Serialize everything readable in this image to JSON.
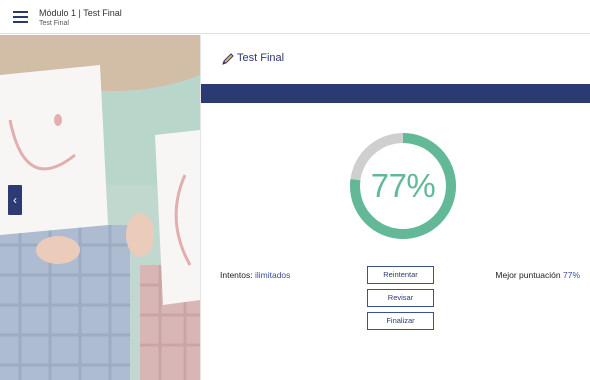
{
  "header": {
    "course_title": "Módulo 1 | Test Final",
    "course_subtitle": "Test Final",
    "menu_icon": "hamburger-menu-icon"
  },
  "sidebar": {
    "back_icon": "chevron-left-icon",
    "back_glyph": "‹"
  },
  "panel": {
    "title": "Test Final",
    "title_icon": "pencil-icon",
    "score_label": "77%",
    "score_value": 0.77,
    "attempts_label": "Intentos:",
    "attempts_value": "ilimitados",
    "best_label": "Mejor puntuación",
    "best_value": "77%",
    "buttons": {
      "retry": "Reintentar",
      "review": "Revisar",
      "finish": "Finalizar"
    }
  },
  "colors": {
    "navy": "#2a3a73",
    "progress": "#63b997",
    "track": "#cfcfcf",
    "link": "#3b4f9a"
  }
}
